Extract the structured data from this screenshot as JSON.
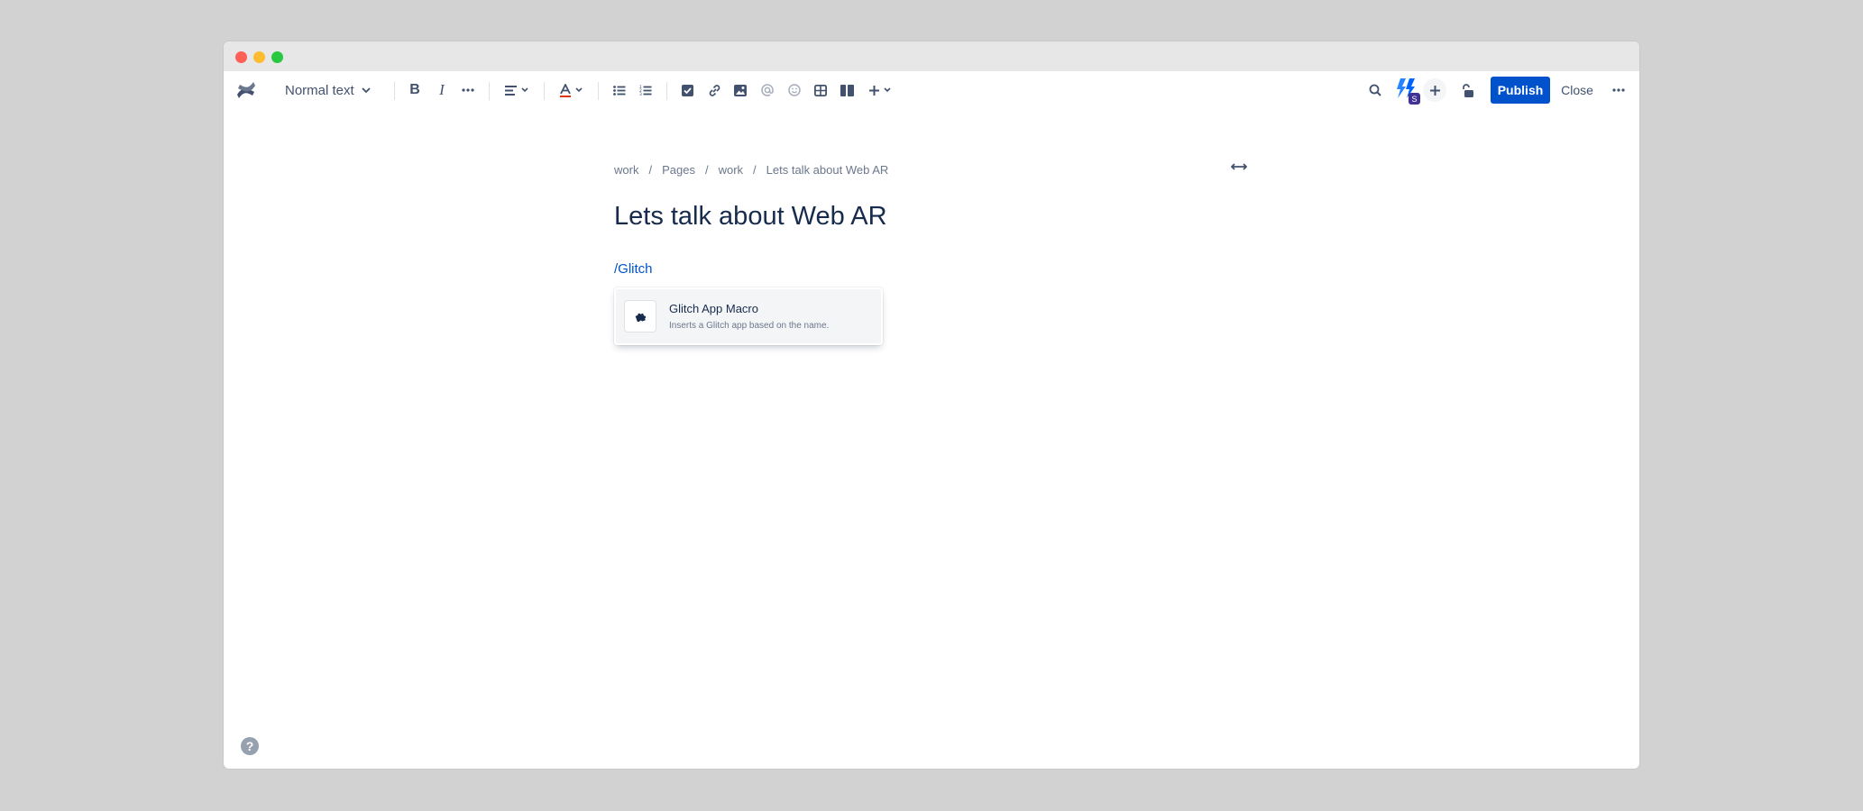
{
  "toolbar": {
    "text_style": "Normal text",
    "bold_label": "B",
    "italic_label": "I"
  },
  "collab": {
    "badge": "S"
  },
  "actions": {
    "publish_label": "Publish",
    "close_label": "Close"
  },
  "breadcrumb": [
    "work",
    "Pages",
    "work",
    "Lets talk about Web AR"
  ],
  "page": {
    "title": "Lets talk about Web AR",
    "slash_command": "/Glitch"
  },
  "menu": {
    "items": [
      {
        "title": "Glitch App Macro",
        "description": "Inserts a Glitch app based on the name.",
        "icon": "puzzle-icon"
      }
    ]
  },
  "help": {
    "label": "?"
  },
  "colors": {
    "primary": "#0052cc",
    "text": "#172b4d",
    "subtle": "#6b778c",
    "icon": "#42526e"
  }
}
